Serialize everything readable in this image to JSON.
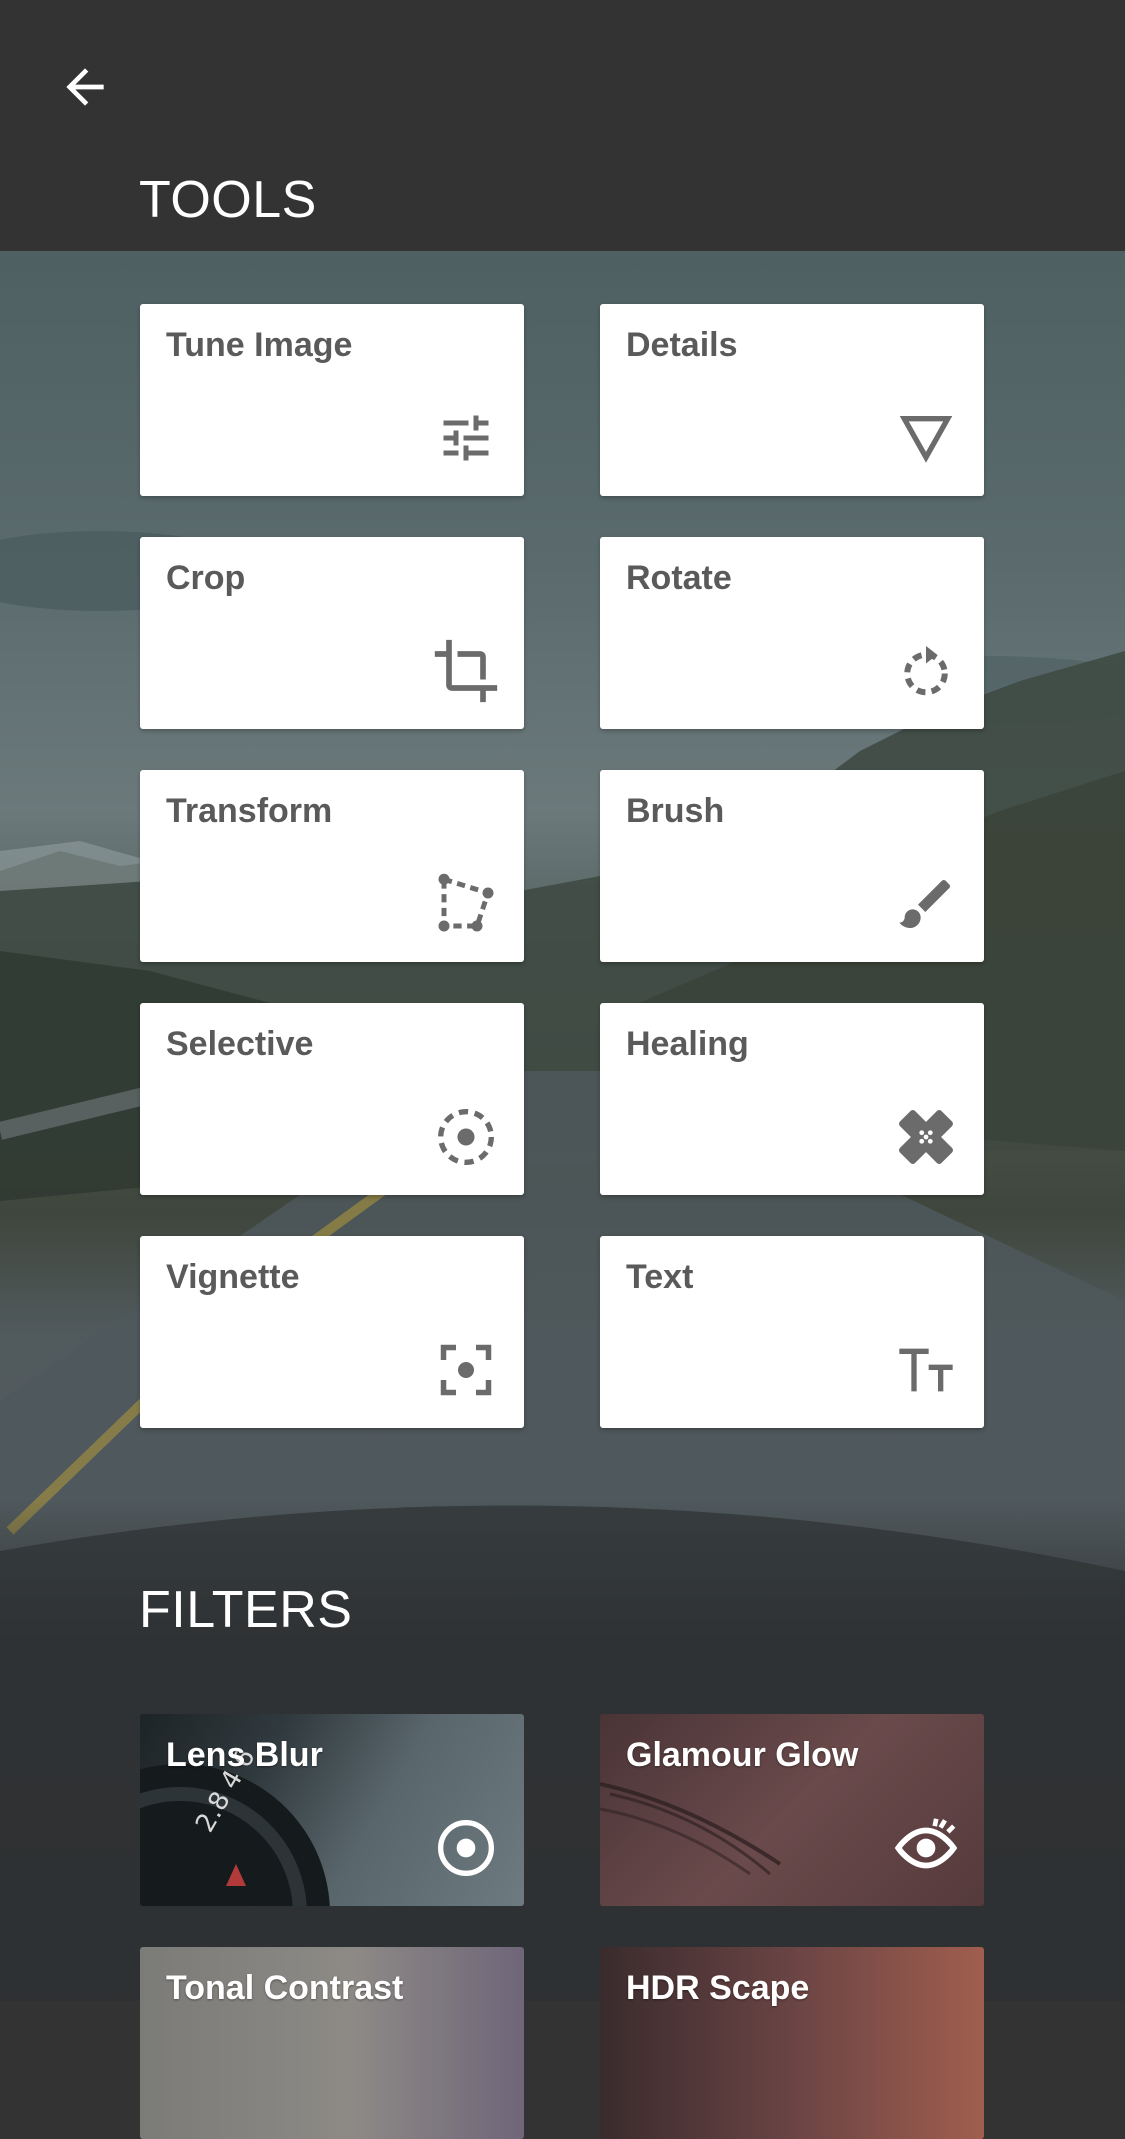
{
  "header": {
    "back_icon": "arrow-left-icon",
    "tools_title": "TOOLS"
  },
  "tools": [
    {
      "label": "Tune Image",
      "icon": "sliders-icon"
    },
    {
      "label": "Details",
      "icon": "triangle-down-icon"
    },
    {
      "label": "Crop",
      "icon": "crop-icon"
    },
    {
      "label": "Rotate",
      "icon": "rotate-icon"
    },
    {
      "label": "Transform",
      "icon": "transform-icon"
    },
    {
      "label": "Brush",
      "icon": "brush-icon"
    },
    {
      "label": "Selective",
      "icon": "selective-icon"
    },
    {
      "label": "Healing",
      "icon": "bandage-icon"
    },
    {
      "label": "Vignette",
      "icon": "vignette-icon"
    },
    {
      "label": "Text",
      "icon": "text-icon"
    }
  ],
  "filters_title": "FILTERS",
  "filters": [
    {
      "label": "Lens Blur",
      "icon": "target-icon"
    },
    {
      "label": "Glamour Glow",
      "icon": "eye-icon"
    },
    {
      "label": "Tonal Contrast",
      "icon": ""
    },
    {
      "label": "HDR Scape",
      "icon": ""
    }
  ],
  "lens_blur_text": "2.8 4 6",
  "colors": {
    "header_bg": "#333333",
    "card_bg": "#ffffff",
    "card_text": "#5a5a5a",
    "icon_color": "#6b6b6b"
  }
}
